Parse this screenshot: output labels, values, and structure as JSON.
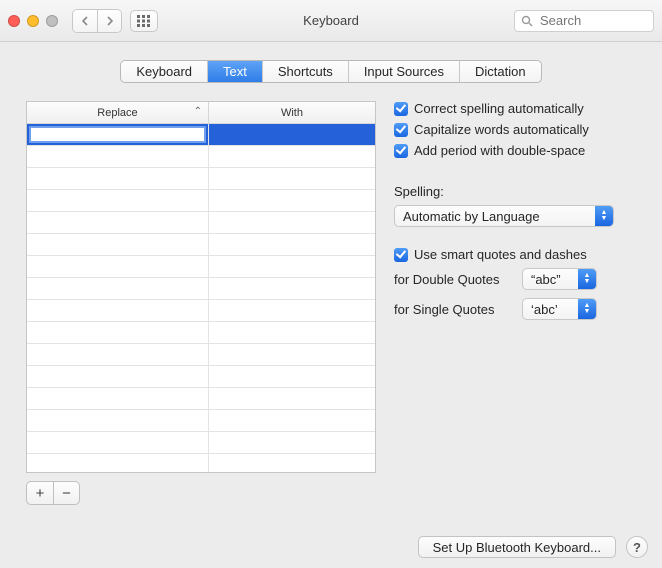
{
  "window": {
    "title": "Keyboard",
    "search_placeholder": "Search"
  },
  "tabs": [
    {
      "label": "Keyboard",
      "active": false
    },
    {
      "label": "Text",
      "active": true
    },
    {
      "label": "Shortcuts",
      "active": false
    },
    {
      "label": "Input Sources",
      "active": false
    },
    {
      "label": "Dictation",
      "active": false
    }
  ],
  "table": {
    "col_replace": "Replace",
    "col_with": "With",
    "row_count": 16,
    "selected_index": 0
  },
  "buttons": {
    "add": "+",
    "remove": "−",
    "setup_bt": "Set Up Bluetooth Keyboard...",
    "help": "?"
  },
  "checks": {
    "correct_spelling": "Correct spelling automatically",
    "capitalize": "Capitalize words automatically",
    "add_period": "Add period with double-space",
    "smart_quotes": "Use smart quotes and dashes"
  },
  "spelling": {
    "label": "Spelling:",
    "value": "Automatic by Language"
  },
  "quotes": {
    "double_label": "for Double Quotes",
    "double_value": "“abc”",
    "single_label": "for Single Quotes",
    "single_value": "‘abc’"
  }
}
